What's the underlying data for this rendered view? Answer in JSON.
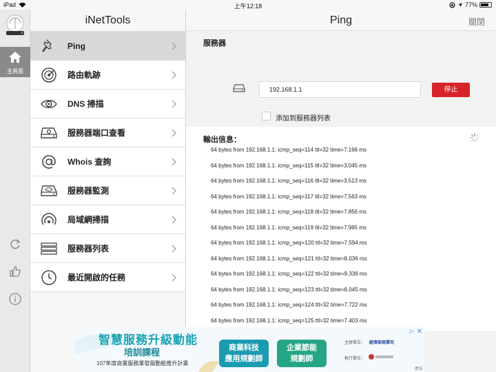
{
  "status_bar": {
    "device": "iPad",
    "time": "上午12:18",
    "battery": "77%"
  },
  "rail": {
    "home_label": "主頁面"
  },
  "menu": {
    "title": "iNetTools",
    "items": [
      {
        "label": "Ping",
        "icon": "pin-icon"
      },
      {
        "label": "路由軌跡",
        "icon": "radar-icon"
      },
      {
        "label": "DNS 掃描",
        "icon": "eye-icon"
      },
      {
        "label": "服務器端口查看",
        "icon": "drive-search-icon"
      },
      {
        "label": "Whois 查詢",
        "icon": "at-icon"
      },
      {
        "label": "服務器監測",
        "icon": "drive-eye-icon"
      },
      {
        "label": "局域網掃描",
        "icon": "wifi-icon"
      },
      {
        "label": "服務器列表",
        "icon": "list-icon"
      },
      {
        "label": "最近開啟的任務",
        "icon": "clock-icon"
      }
    ]
  },
  "nav": {
    "title": "Ping",
    "close": "關閉"
  },
  "server": {
    "heading": "服務器",
    "host": "192.168.1.1",
    "stop": "停止",
    "add_to_list": "添加到服務器列表"
  },
  "output": {
    "heading": "輸出信息：",
    "lines": [
      "64 bytes from 192.168.1.1: icmp_seq=114 ttl=32 time=7.166 ms",
      "64 bytes from 192.168.1.1: icmp_seq=115 ttl=32 time=3.045 ms",
      "64 bytes from 192.168.1.1: icmp_seq=116 ttl=32 time=3.513 ms",
      "64 bytes from 192.168.1.1: icmp_seq=117 ttl=32 time=7.563 ms",
      "64 bytes from 192.168.1.1: icmp_seq=118 ttl=32 time=7.856 ms",
      "64 bytes from 192.168.1.1: icmp_seq=119 ttl=32 time=7.965 ms",
      "64 bytes from 192.168.1.1: icmp_seq=120 ttl=32 time=7.594 ms",
      "64 bytes from 192.168.1.1: icmp_seq=121 ttl=32 time=8.036 ms",
      "64 bytes from 192.168.1.1: icmp_seq=122 ttl=32 time=9.336 ms",
      "64 bytes from 192.168.1.1: icmp_seq=123 ttl=32 time=6.045 ms",
      "64 bytes from 192.168.1.1: icmp_seq=124 ttl=32 time=7.722 ms",
      "64 bytes from 192.168.1.1: icmp_seq=125 ttl=32 time=7.403 ms"
    ]
  },
  "ad": {
    "title": "智慧服務升級動能",
    "subtitle": "培訓課程",
    "plan": "107年度商業服務業發展動能推升計畫",
    "button1": [
      "商業科技",
      "應用規劃師"
    ],
    "button2": [
      "企業節能",
      "規劃師"
    ],
    "org1": "主辦單位：",
    "org1_name": "經濟部商業司",
    "org2": "執行單位：",
    "badge": "廣告"
  },
  "colors": {
    "stop_button": "#d8222a",
    "active_menu": "#d8d8d8"
  }
}
